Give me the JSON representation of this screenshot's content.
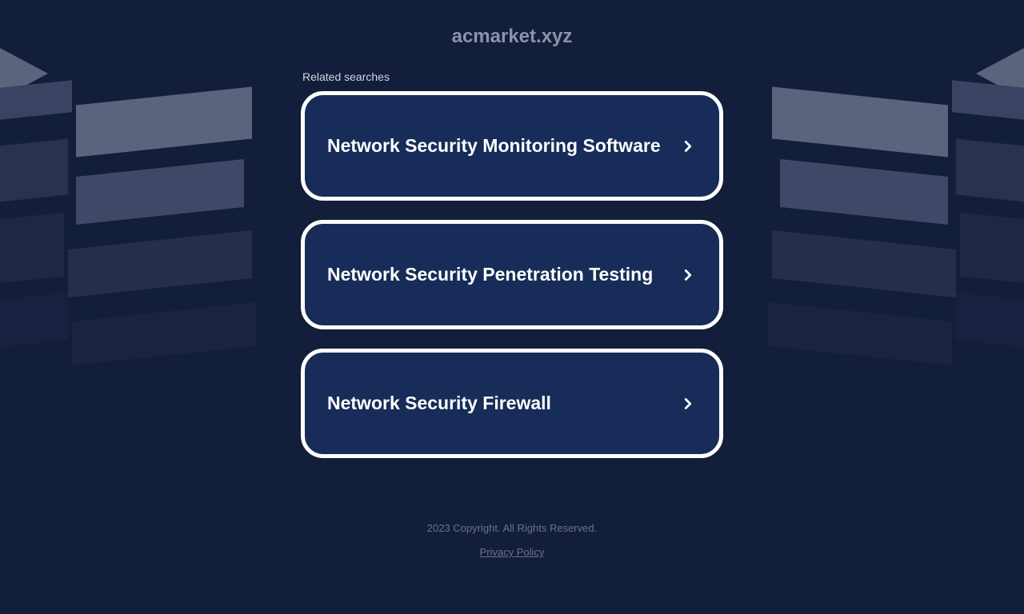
{
  "domain": "acmarket.xyz",
  "related_searches_label": "Related searches",
  "search_items": [
    {
      "label": "Network Security Monitoring Software"
    },
    {
      "label": "Network Security Penetration Testing"
    },
    {
      "label": "Network Security Firewall"
    }
  ],
  "footer": {
    "copyright": "2023 Copyright. All Rights Reserved.",
    "privacy_link": "Privacy Policy"
  }
}
